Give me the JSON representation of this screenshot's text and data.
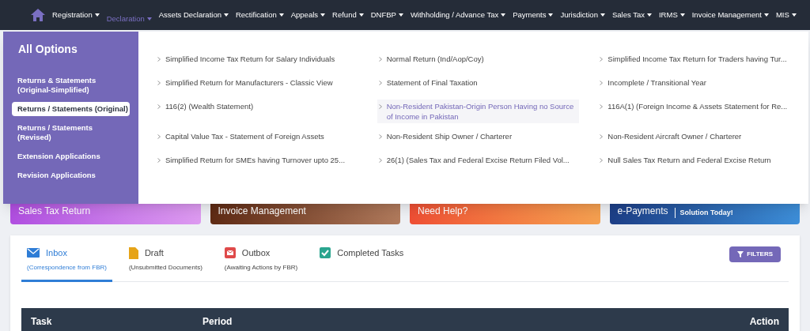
{
  "nav": {
    "items": [
      {
        "label": "Registration",
        "selected": false
      },
      {
        "label": "Declaration",
        "selected": true
      },
      {
        "label": "Assets Declaration",
        "selected": false
      },
      {
        "label": "Rectification",
        "selected": false
      },
      {
        "label": "Appeals",
        "selected": false
      },
      {
        "label": "Refund",
        "selected": false
      },
      {
        "label": "DNFBP",
        "selected": false
      },
      {
        "label": "Withholding / Advance Tax",
        "selected": false
      },
      {
        "label": "Payments",
        "selected": false
      },
      {
        "label": "Jurisdiction",
        "selected": false
      },
      {
        "label": "Sales Tax",
        "selected": false
      },
      {
        "label": "IRMS",
        "selected": false
      },
      {
        "label": "Invoice Management",
        "selected": false
      },
      {
        "label": "MIS",
        "selected": false
      }
    ]
  },
  "dropdown": {
    "title": "All Options",
    "categories": [
      {
        "label": "Returns & Statements (Original-Simplified)",
        "selected": false
      },
      {
        "label": "Returns / Statements (Original)",
        "selected": true
      },
      {
        "label": "Returns / Statements (Revised)",
        "selected": false
      },
      {
        "label": "Extension Applications",
        "selected": false
      },
      {
        "label": "Revision Applications",
        "selected": false
      }
    ],
    "options": [
      {
        "label": "Simplified Income Tax Return for Salary Individuals",
        "highlighted": false
      },
      {
        "label": "Normal Return (Ind/Aop/Coy)",
        "highlighted": false
      },
      {
        "label": "Simplified Income Tax Return for Traders having Tur...",
        "highlighted": false
      },
      {
        "label": "Simplified Return for Manufacturers - Classic View",
        "highlighted": false
      },
      {
        "label": "Statement of Final Taxation",
        "highlighted": false
      },
      {
        "label": "Incomplete / Transitional Year",
        "highlighted": false
      },
      {
        "label": "116(2) (Wealth Statement)",
        "highlighted": false
      },
      {
        "label": "Non-Resident Pakistan-Origin Person Having no Source of Income in Pakistan",
        "highlighted": true
      },
      {
        "label": "116A(1) (Foreign Income & Assets Statement for Re...",
        "highlighted": false
      },
      {
        "label": "Capital Value Tax - Statement of Foreign Assets",
        "highlighted": false
      },
      {
        "label": "Non-Resident Ship Owner / Charterer",
        "highlighted": false
      },
      {
        "label": "Non-Resident Aircraft Owner / Charterer",
        "highlighted": false
      },
      {
        "label": "Simplified Return for SMEs having Turnover upto 25...",
        "highlighted": false
      },
      {
        "label": "26(1) (Sales Tax and Federal Excise Return Filed Vol...",
        "highlighted": false
      },
      {
        "label": "Null Sales Tax Return and Federal Excise Return",
        "highlighted": false
      }
    ]
  },
  "banners": [
    {
      "kind": "sales",
      "title": "Sales Tax Return"
    },
    {
      "kind": "invoice",
      "title": "Invoice Management"
    },
    {
      "kind": "help",
      "title": "Need Help?"
    },
    {
      "kind": "payments",
      "title": "e-Payments",
      "subtitle": "Solution Today!"
    }
  ],
  "mailbox": {
    "tabs": [
      {
        "kind": "inbox",
        "label": "Inbox",
        "sublabel": "(Correspondence from FBR)",
        "selected": true
      },
      {
        "kind": "draft",
        "label": "Draft",
        "sublabel": "(Unsubmitted Documents)",
        "selected": false
      },
      {
        "kind": "outbox",
        "label": "Outbox",
        "sublabel": "(Awaiting Actions by FBR)",
        "selected": false
      },
      {
        "kind": "completed",
        "label": "Completed Tasks",
        "selected": false
      }
    ],
    "filters_button": "FILTERS",
    "table": {
      "columns": [
        "Task",
        "Period",
        "Action"
      ]
    }
  }
}
